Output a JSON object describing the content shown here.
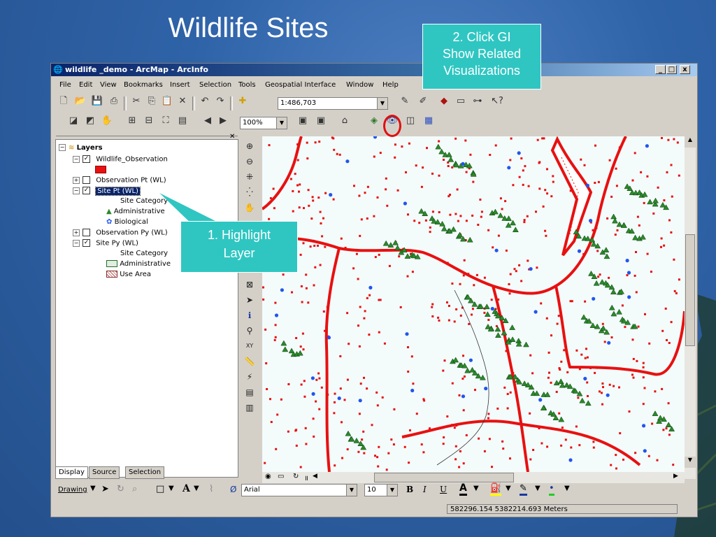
{
  "slide": {
    "title": "Wildlife Sites",
    "callout_gi": [
      "2.  Click GI",
      "Show Related",
      "Visualizations"
    ],
    "callout_layer": [
      "1.  Highlight",
      "Layer"
    ]
  },
  "window": {
    "title": "wildlife _demo - ArcMap - ArcInfo",
    "controls": [
      "_",
      "□",
      "x"
    ]
  },
  "menu": [
    "File",
    "Edit",
    "View",
    "Bookmarks",
    "Insert",
    "Selection",
    "Tools",
    "Geospatial Interface",
    "Window",
    "Help"
  ],
  "toolbar": {
    "scale": "1:486,703",
    "zoom": "100%"
  },
  "toc": {
    "rows": [
      {
        "label": "Layers",
        "bold": true
      },
      {
        "label": "Wildlife_Observation"
      },
      {
        "label": "Observation Pt (WL)"
      },
      {
        "label": "Site Pt (WL)"
      },
      {
        "label": "Site Category"
      },
      {
        "label": "Administrative"
      },
      {
        "label": "Biological"
      },
      {
        "label": "Observation Py (WL)"
      },
      {
        "label": "Site Py (WL)"
      },
      {
        "label": "Site Category"
      },
      {
        "label": "Administrative"
      },
      {
        "label": "Use Area"
      }
    ],
    "tabs": [
      "Display",
      "Source",
      "Selection"
    ]
  },
  "drawing": {
    "label": "Drawing",
    "font": "Arial",
    "size": "10",
    "bold": "B",
    "italic": "I",
    "underline": "U",
    "text_a": "A"
  },
  "status": {
    "coords": "582296.154  5382214.693 Meters"
  },
  "colors": {
    "road": "#e81010",
    "point": "#e81010",
    "admin": "#2a8a2a",
    "bio": "#2255ee",
    "callout": "#2fc6c2"
  }
}
